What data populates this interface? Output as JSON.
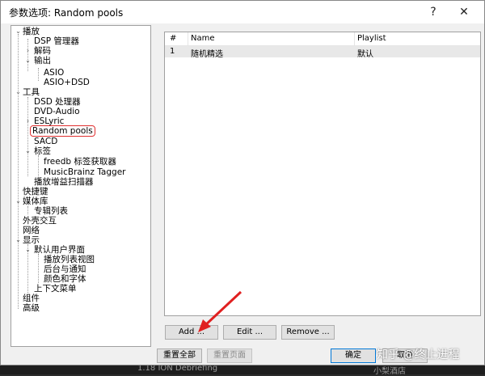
{
  "window": {
    "title": "参数选项: Random pools",
    "help_label": "?",
    "close_label": "✕"
  },
  "tree": {
    "items": [
      {
        "label": "播放"
      },
      {
        "label": "DSP 管理器"
      },
      {
        "label": "解码"
      },
      {
        "label": "输出"
      },
      {
        "label": "ASIO"
      },
      {
        "label": "ASIO+DSD"
      },
      {
        "label": "工具"
      },
      {
        "label": "DSD 处理器"
      },
      {
        "label": "DVD-Audio"
      },
      {
        "label": "ESLyric"
      },
      {
        "label": "Random pools"
      },
      {
        "label": "SACD"
      },
      {
        "label": "标签"
      },
      {
        "label": "freedb 标签获取器"
      },
      {
        "label": "MusicBrainz Tagger"
      },
      {
        "label": "播放增益扫描器"
      },
      {
        "label": "快捷键"
      },
      {
        "label": "媒体库"
      },
      {
        "label": "专辑列表"
      },
      {
        "label": "外壳交互"
      },
      {
        "label": "网络"
      },
      {
        "label": "显示"
      },
      {
        "label": "默认用户界面"
      },
      {
        "label": "播放列表视图"
      },
      {
        "label": "后台与通知"
      },
      {
        "label": "颜色和字体"
      },
      {
        "label": "上下文菜单"
      },
      {
        "label": "组件"
      },
      {
        "label": "高级"
      }
    ],
    "selected": "Random pools"
  },
  "pool_list": {
    "columns": [
      "#",
      "Name",
      "Playlist"
    ],
    "rows": [
      {
        "num": "1",
        "name": "随机精选",
        "playlist": "默认"
      }
    ]
  },
  "buttons": {
    "add": "Add ...",
    "edit": "Edit ...",
    "remove": "Remove ...",
    "reset_all": "重置全部",
    "reset_page": "重置页面",
    "ok": "确定",
    "cancel": "取消"
  },
  "background_text": {
    "track": "1.18   ION Debriefing",
    "sub": "小梨酒店"
  },
  "watermark": "知乎 @终止进程",
  "colors": {
    "selection_highlight": "#e03030",
    "annotation_arrow": "#e02020",
    "dialog_bg": "#f0f0f0"
  }
}
